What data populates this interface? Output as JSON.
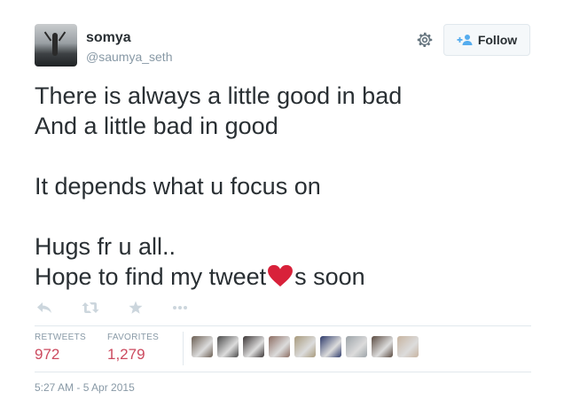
{
  "user": {
    "display_name": "somya",
    "handle": "@saumya_seth"
  },
  "follow_button": {
    "label": "Follow"
  },
  "tweet": {
    "line1": "There is always a little good in bad",
    "line2": "And a little bad in good",
    "line3": "It depends what u focus on",
    "line4": "Hugs fr u all..",
    "line5_before": "Hope to find my tweet",
    "line5_after": "s soon"
  },
  "stats": {
    "retweets_label": "RETWEETS",
    "retweets_value": "972",
    "favorites_label": "FAVORITES",
    "favorites_value": "1,279"
  },
  "timestamp": "5:27 AM - 5 Apr 2015",
  "colors": {
    "stat_value": "#cc4a5f",
    "heart": "#d8213a"
  },
  "favoriters": [
    {
      "color": "#6b5e52"
    },
    {
      "color": "#4a4a4a"
    },
    {
      "color": "#3b3535"
    },
    {
      "color": "#8c6d62"
    },
    {
      "color": "#a89a7c"
    },
    {
      "color": "#2d3a6a"
    },
    {
      "color": "#9ca3a8"
    },
    {
      "color": "#5a4a40"
    },
    {
      "color": "#c7b4a0"
    }
  ]
}
